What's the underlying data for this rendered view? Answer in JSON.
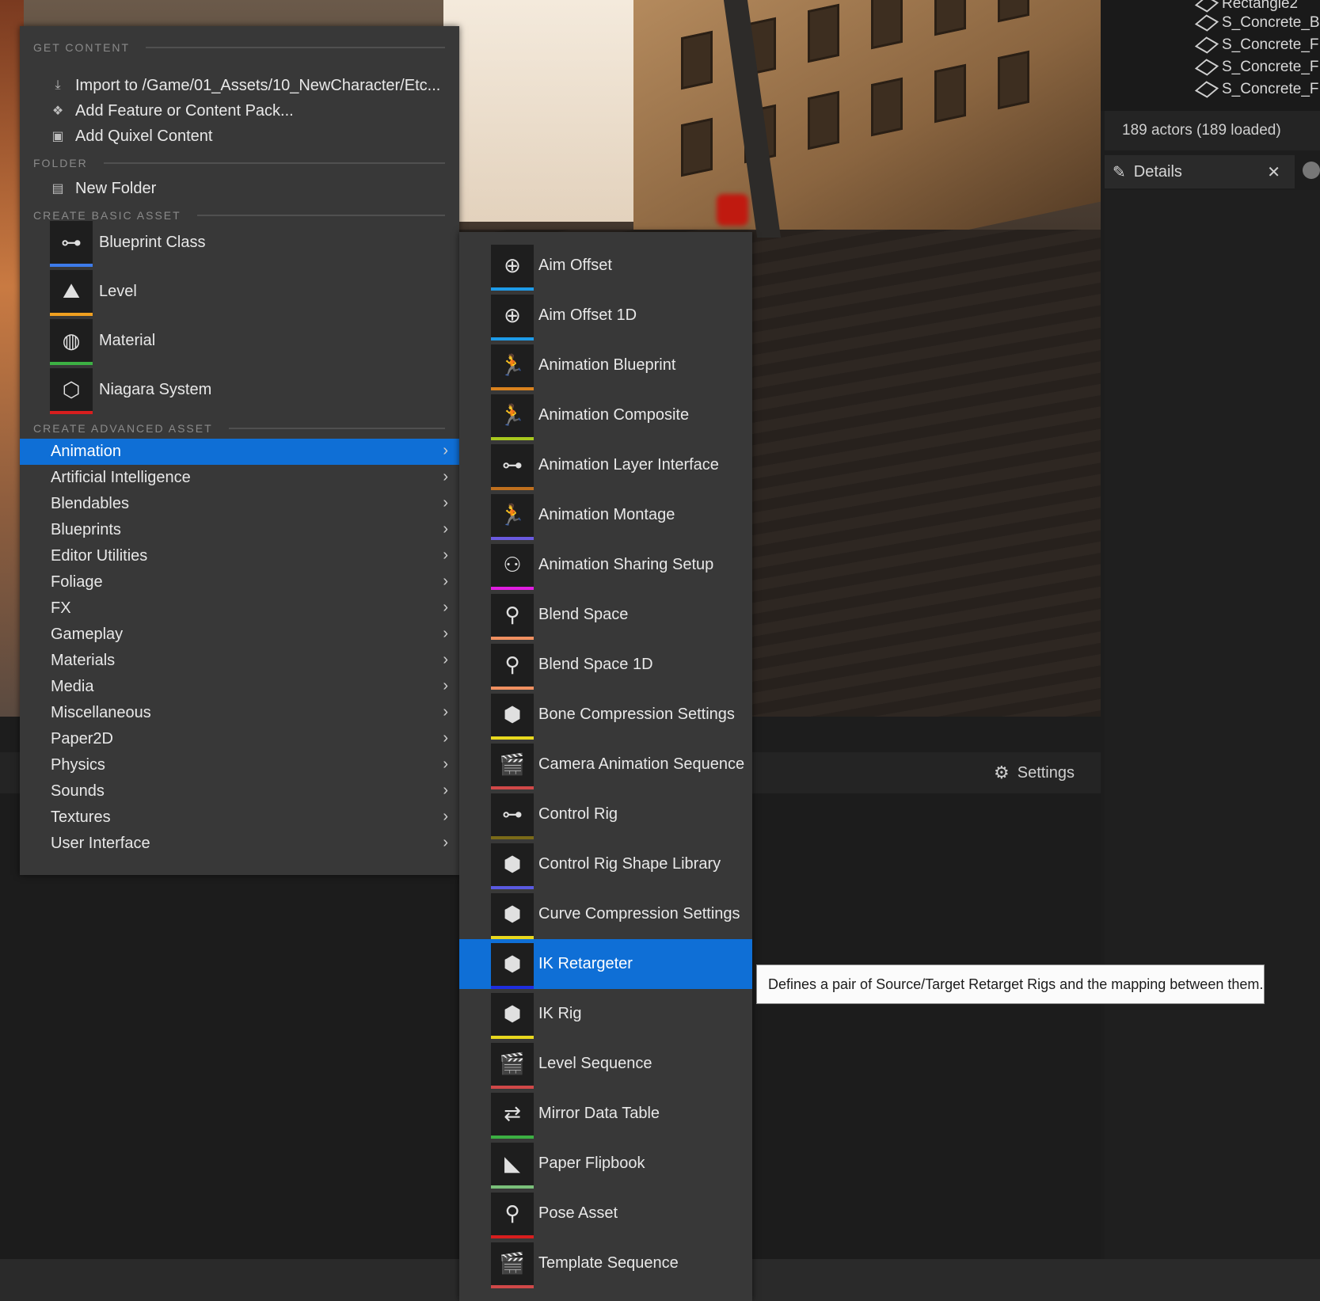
{
  "outliner": {
    "rows": [
      "Rectangle2",
      "S_Concrete_B",
      "S_Concrete_F",
      "S_Concrete_F",
      "S_Concrete_F"
    ],
    "actors_count": "189 actors (189 loaded)"
  },
  "details_tab": {
    "label": "Details",
    "close": "✕"
  },
  "bottom_toolbar": {
    "settings_label": "Settings"
  },
  "main_menu": {
    "get_content_header": "GET CONTENT",
    "get_content_items": [
      {
        "label": "Import to /Game/01_Assets/10_NewCharacter/Etc...",
        "icon": "import-icon"
      },
      {
        "label": "Add Feature or Content Pack...",
        "icon": "feature-pack-icon"
      },
      {
        "label": "Add Quixel Content",
        "icon": "quixel-icon"
      }
    ],
    "folder_header": "FOLDER",
    "folder_items": [
      {
        "label": "New Folder",
        "icon": "new-folder-icon"
      }
    ],
    "basic_header": "CREATE BASIC ASSET",
    "basic_items": [
      {
        "label": "Blueprint Class",
        "icon": "blueprint-icon",
        "color": "#3d7bea"
      },
      {
        "label": "Level",
        "icon": "level-icon",
        "color": "#f0a020"
      },
      {
        "label": "Material",
        "icon": "material-icon",
        "color": "#3cb043"
      },
      {
        "label": "Niagara System",
        "icon": "niagara-icon",
        "color": "#d81e1e"
      }
    ],
    "advanced_header": "CREATE ADVANCED ASSET",
    "categories": [
      "Animation",
      "Artificial Intelligence",
      "Blendables",
      "Blueprints",
      "Editor Utilities",
      "Foliage",
      "FX",
      "Gameplay",
      "Materials",
      "Media",
      "Miscellaneous",
      "Paper2D",
      "Physics",
      "Sounds",
      "Textures",
      "User Interface"
    ],
    "selected_category": "Animation"
  },
  "sub_menu": {
    "items": [
      {
        "label": "Aim Offset",
        "icon": "aim-offset-icon",
        "color": "#1e9be8"
      },
      {
        "label": "Aim Offset 1D",
        "icon": "aim-offset-icon",
        "color": "#1e9be8"
      },
      {
        "label": "Animation Blueprint",
        "icon": "anim-blueprint-icon",
        "color": "#d9821e"
      },
      {
        "label": "Animation Composite",
        "icon": "anim-composite-icon",
        "color": "#a8c81e"
      },
      {
        "label": "Animation Layer Interface",
        "icon": "layer-interface-icon",
        "color": "#c0701e"
      },
      {
        "label": "Animation Montage",
        "icon": "montage-icon",
        "color": "#6a5ae0"
      },
      {
        "label": "Animation Sharing Setup",
        "icon": "sharing-icon",
        "color": "#e01ee0"
      },
      {
        "label": "Blend Space",
        "icon": "blend-space-icon",
        "color": "#f09060"
      },
      {
        "label": "Blend Space 1D",
        "icon": "blend-space-icon",
        "color": "#f09060"
      },
      {
        "label": "Bone Compression Settings",
        "icon": "cube-icon",
        "color": "#e8d81e"
      },
      {
        "label": "Camera Animation Sequence",
        "icon": "clapper-icon",
        "color": "#d04848"
      },
      {
        "label": "Control Rig",
        "icon": "control-rig-icon",
        "color": "#7a6a18"
      },
      {
        "label": "Control Rig Shape Library",
        "icon": "cube-icon",
        "color": "#5a5ae0"
      },
      {
        "label": "Curve Compression Settings",
        "icon": "cube-icon",
        "color": "#e8d81e"
      },
      {
        "label": "IK Retargeter",
        "icon": "cube-icon",
        "color": "#1e2ee0"
      },
      {
        "label": "IK Rig",
        "icon": "cube-icon",
        "color": "#e8d81e"
      },
      {
        "label": "Level Sequence",
        "icon": "clapper-icon",
        "color": "#d04848"
      },
      {
        "label": "Mirror Data Table",
        "icon": "mirror-icon",
        "color": "#3cb043"
      },
      {
        "label": "Paper Flipbook",
        "icon": "flipbook-icon",
        "color": "#7ac07a"
      },
      {
        "label": "Pose Asset",
        "icon": "pose-icon",
        "color": "#d81e1e"
      },
      {
        "label": "Template Sequence",
        "icon": "clapper-icon",
        "color": "#d04848"
      }
    ],
    "selected_item": "IK Retargeter"
  },
  "tooltip": "Defines a pair of Source/Target Retarget Rigs and the mapping between them."
}
